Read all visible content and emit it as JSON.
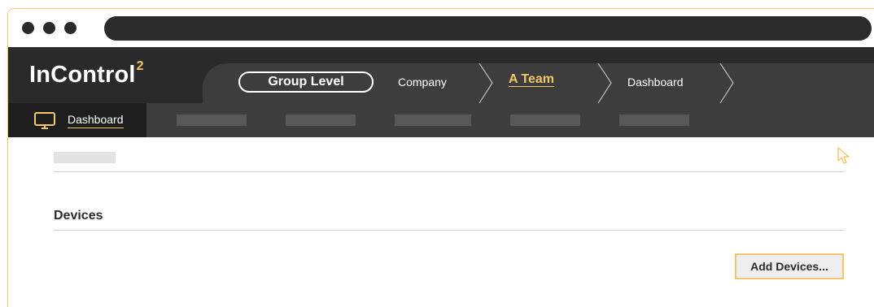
{
  "app": {
    "logo_text": "InControl",
    "logo_superscript": "2"
  },
  "breadcrumb": {
    "group_level": "Group Level",
    "company": "Company",
    "team": "A Team",
    "dashboard": "Dashboard"
  },
  "nav": {
    "active_label": "Dashboard",
    "active_icon": "monitor-icon"
  },
  "content": {
    "devices_heading": "Devices",
    "add_devices_label": "Add Devices..."
  },
  "colors": {
    "accent": "#f2c66a",
    "topbar": "#2a2a2a",
    "navbar": "#3d3d3d"
  }
}
